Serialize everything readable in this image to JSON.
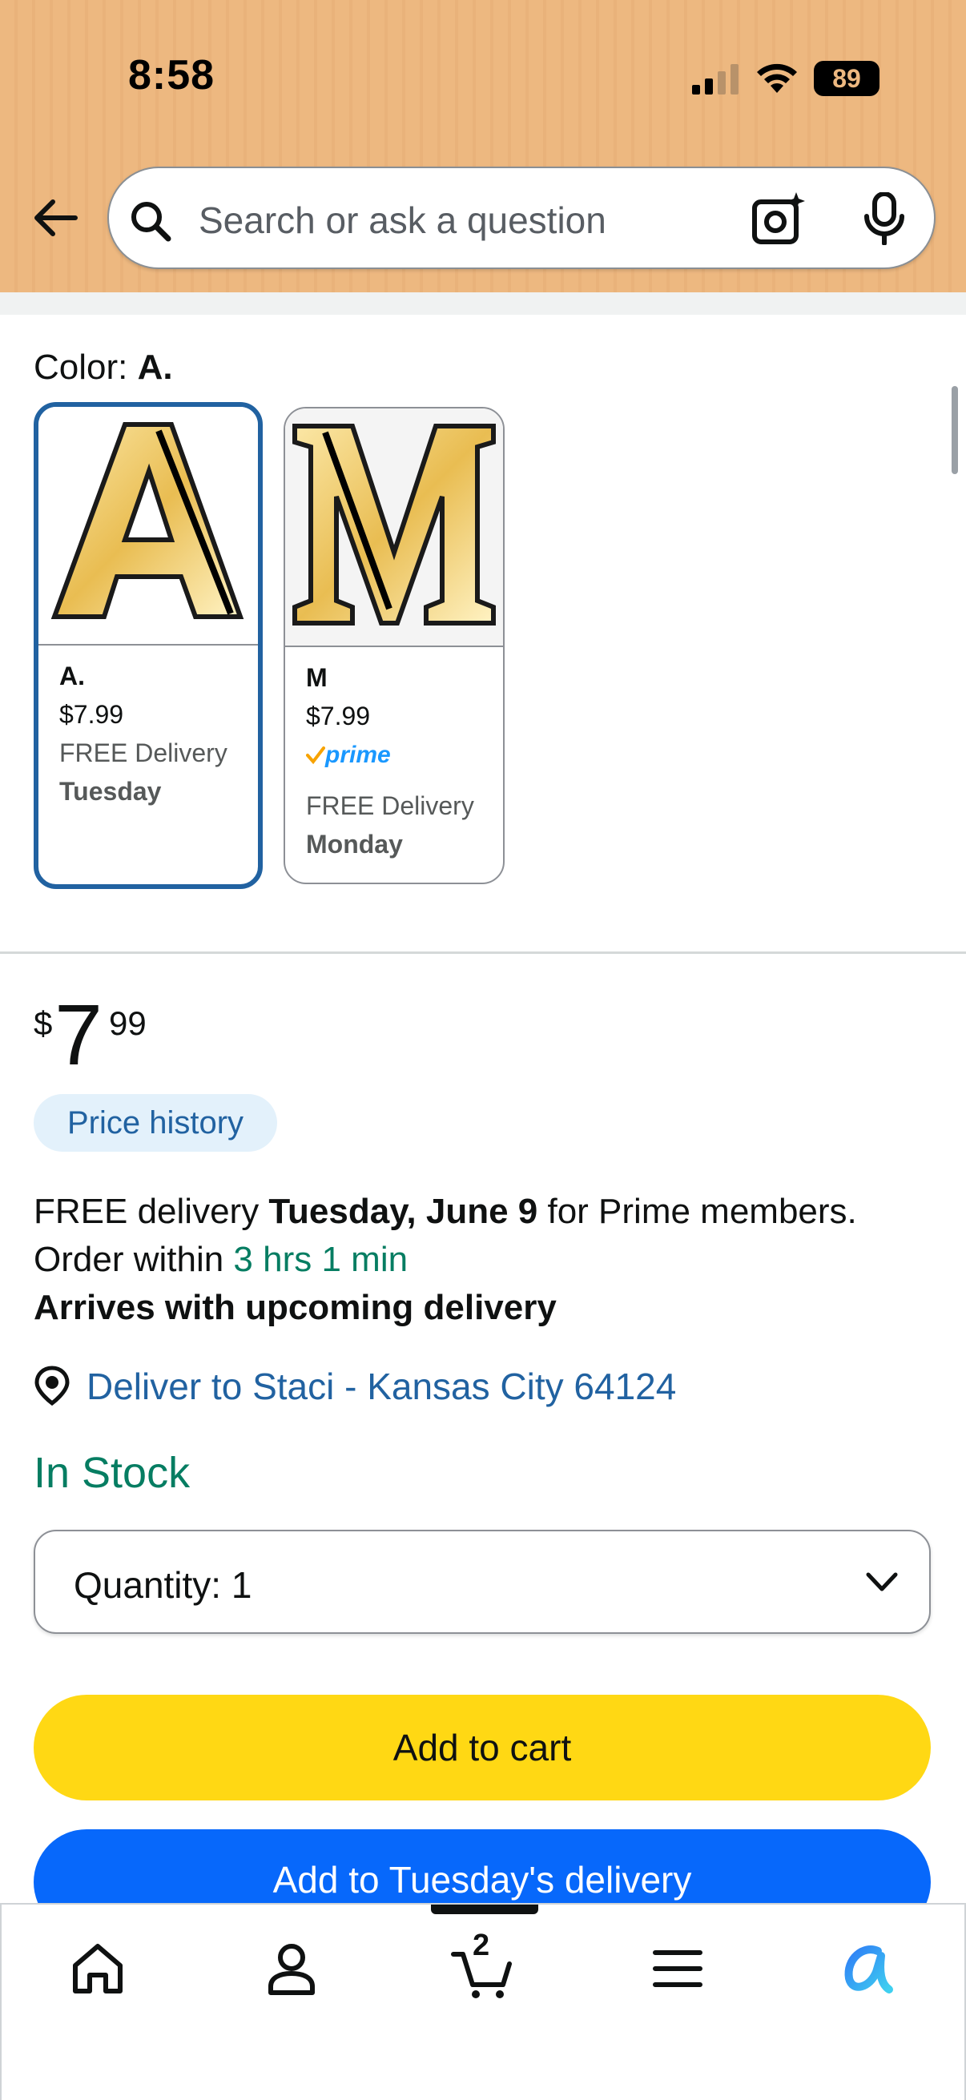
{
  "status_bar": {
    "time": "8:58",
    "battery": "89"
  },
  "search": {
    "placeholder": "Search or ask a question"
  },
  "color": {
    "label": "Color:",
    "selected": "A."
  },
  "swatches": [
    {
      "name": "A.",
      "price": "$7.99",
      "delivery": "FREE Delivery",
      "day": "Tuesday",
      "letter": "A"
    },
    {
      "name": "M",
      "price": "$7.99",
      "prime": "prime",
      "delivery": "FREE Delivery",
      "day": "Monday",
      "letter": "M"
    }
  ],
  "price": {
    "symbol": "$",
    "whole": "7",
    "fraction": "99"
  },
  "price_history_label": "Price history",
  "delivery": {
    "prefix": "FREE delivery ",
    "date": "Tuesday, June 9",
    "suffix": " for Prime members.",
    "order_within_prefix": "Order within ",
    "order_within_time": "3 hrs 1 min",
    "arrives": "Arrives with upcoming delivery"
  },
  "deliver_to": "Deliver to Staci - Kansas City 64124",
  "stock_status": "In Stock",
  "quantity": {
    "label": "Quantity:",
    "value": "1"
  },
  "buttons": {
    "add_to_cart": "Add to cart",
    "add_to_delivery": "Add to Tuesday's delivery"
  },
  "nav": {
    "cart_count": "2"
  },
  "colors": {
    "header": "#edb880",
    "link": "#2162a1",
    "green": "#067d62",
    "cart_button": "#ffd814",
    "delivery_button": "#0768fb"
  }
}
